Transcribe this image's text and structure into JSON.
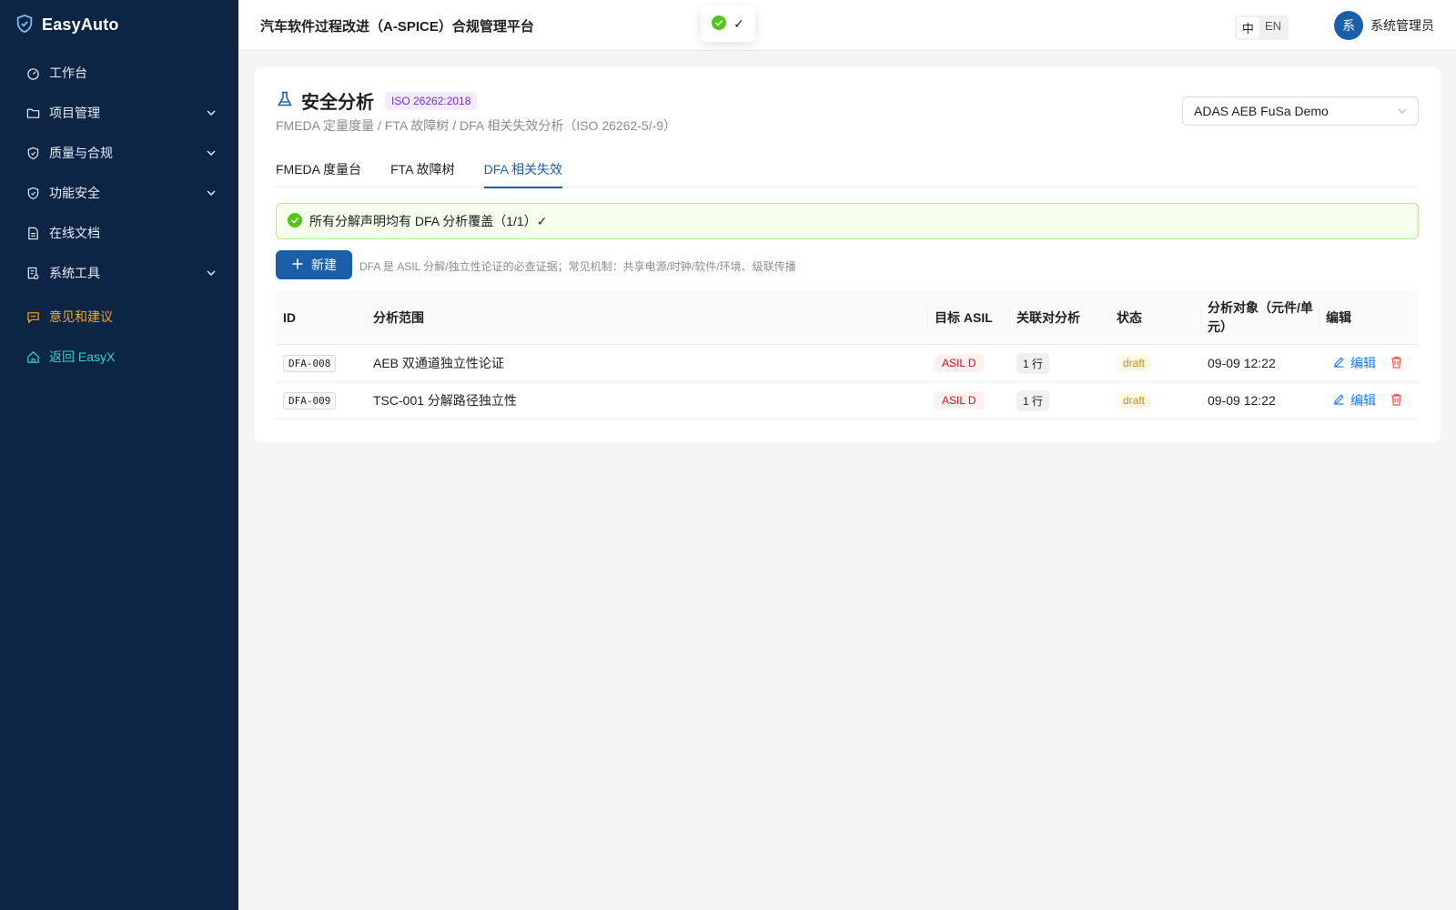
{
  "app": {
    "brand": "EasyAuto",
    "title": "汽车软件过程改进（A-SPICE）合规管理平台"
  },
  "toast": {
    "text": "✓"
  },
  "lang": {
    "zh": "中",
    "en": "EN"
  },
  "user": {
    "avatar": "系",
    "name": "系统管理员"
  },
  "sidebar": {
    "items": [
      {
        "label": "工作台",
        "icon": "dashboard-icon"
      },
      {
        "label": "项目管理",
        "icon": "folder-icon",
        "expandable": true
      },
      {
        "label": "质量与合规",
        "icon": "shield-icon",
        "expandable": true
      },
      {
        "label": "功能安全",
        "icon": "shield-check-icon",
        "expandable": true
      },
      {
        "label": "在线文档",
        "icon": "document-icon"
      },
      {
        "label": "系统工具",
        "icon": "tools-icon",
        "expandable": true
      },
      {
        "label": "意见和建议",
        "icon": "feedback-icon",
        "color": "#f5a623"
      },
      {
        "label": "返回 EasyX",
        "icon": "home-icon",
        "color": "#36cfc9"
      }
    ]
  },
  "page": {
    "title": "安全分析",
    "tag": "ISO 26262:2018",
    "subtitle": "FMEDA 定量度量 / FTA 故障树 / DFA 相关失效分析（ISO 26262-5/-9）",
    "project": "ADAS AEB FuSa Demo"
  },
  "tabs": [
    "FMEDA 度量台",
    "FTA 故障树",
    "DFA 相关失效"
  ],
  "active_tab": 2,
  "alert": {
    "text": "所有分解声明均有 DFA 分析覆盖（1/1）✓"
  },
  "toolbar": {
    "new_label": "新建",
    "hint": "DFA 是 ASIL 分解/独立性论证的必查证据；常见机制：共享电源/时钟/软件/环境、级联传播"
  },
  "table": {
    "headers": [
      "ID",
      "分析范围",
      "目标 ASIL",
      "关联对分析",
      "状态",
      "分析对象（元件/单元）",
      "编辑"
    ],
    "rows": [
      {
        "id": "DFA-008",
        "scope": "AEB 双通道独立性论证",
        "asil": "ASIL D",
        "pairs": "1 行",
        "status": "draft",
        "updated": "09-09 12:22",
        "edit": "编辑"
      },
      {
        "id": "DFA-009",
        "scope": "TSC-001 分解路径独立性",
        "asil": "ASIL D",
        "pairs": "1 行",
        "status": "draft",
        "updated": "09-09 12:22",
        "edit": "编辑"
      }
    ]
  },
  "colors": {
    "sidebar_bg": "#0c2545",
    "primary": "#1a5fa8",
    "success": "#52c41a",
    "danger": "#cf1322",
    "warning": "#d48806"
  }
}
